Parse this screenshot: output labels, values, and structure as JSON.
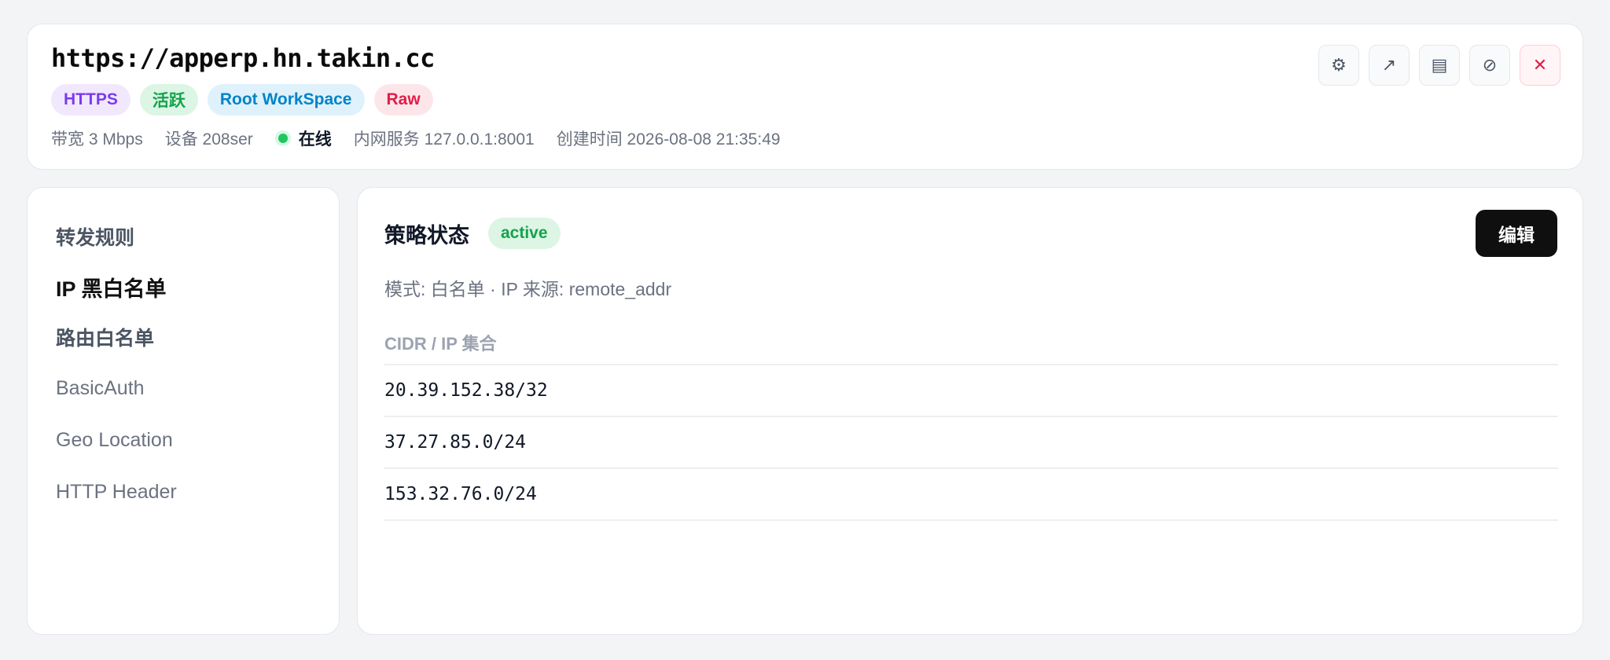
{
  "header": {
    "url": "https://apperp.hn.takin.cc",
    "badges": [
      "HTTPS",
      "活跃",
      "Root WorkSpace",
      "Raw"
    ],
    "meta": {
      "bandwidth": "带宽 3 Mbps",
      "device": "设备 208ser",
      "status": "在线",
      "internal_service": "内网服务 127.0.0.1:8001",
      "created": "创建时间 2026-08-08 21:35:49"
    },
    "actions": [
      {
        "icon": "gear-icon",
        "glyph": "⚙"
      },
      {
        "icon": "external-link-icon",
        "glyph": "↗"
      },
      {
        "icon": "log-icon",
        "glyph": "▤"
      },
      {
        "icon": "disable-icon",
        "glyph": "⊘"
      },
      {
        "icon": "close-icon",
        "glyph": "✕"
      }
    ]
  },
  "sidebar": {
    "items": [
      "转发规则",
      "IP 黑白名单",
      "路由白名单",
      "BasicAuth",
      "Geo Location",
      "HTTP Header"
    ],
    "selected": "IP 黑白名单"
  },
  "main": {
    "policy_title": "策略状态",
    "policy_status": "active",
    "edit_label": "编辑",
    "mode_text": "模式: 白名单 · IP 来源: remote_addr",
    "table_header": "CIDR / IP 集合",
    "rows": [
      "20.39.152.38/32",
      "37.27.85.0/24",
      "153.32.76.0/24"
    ]
  },
  "colors": {
    "accent_dark": "#0f0f10",
    "online_green": "#22c55e",
    "https_purple": "#7c3aed",
    "active_green": "#16a34a",
    "workspace_blue": "#0284c7",
    "raw_red": "#e11d48"
  }
}
